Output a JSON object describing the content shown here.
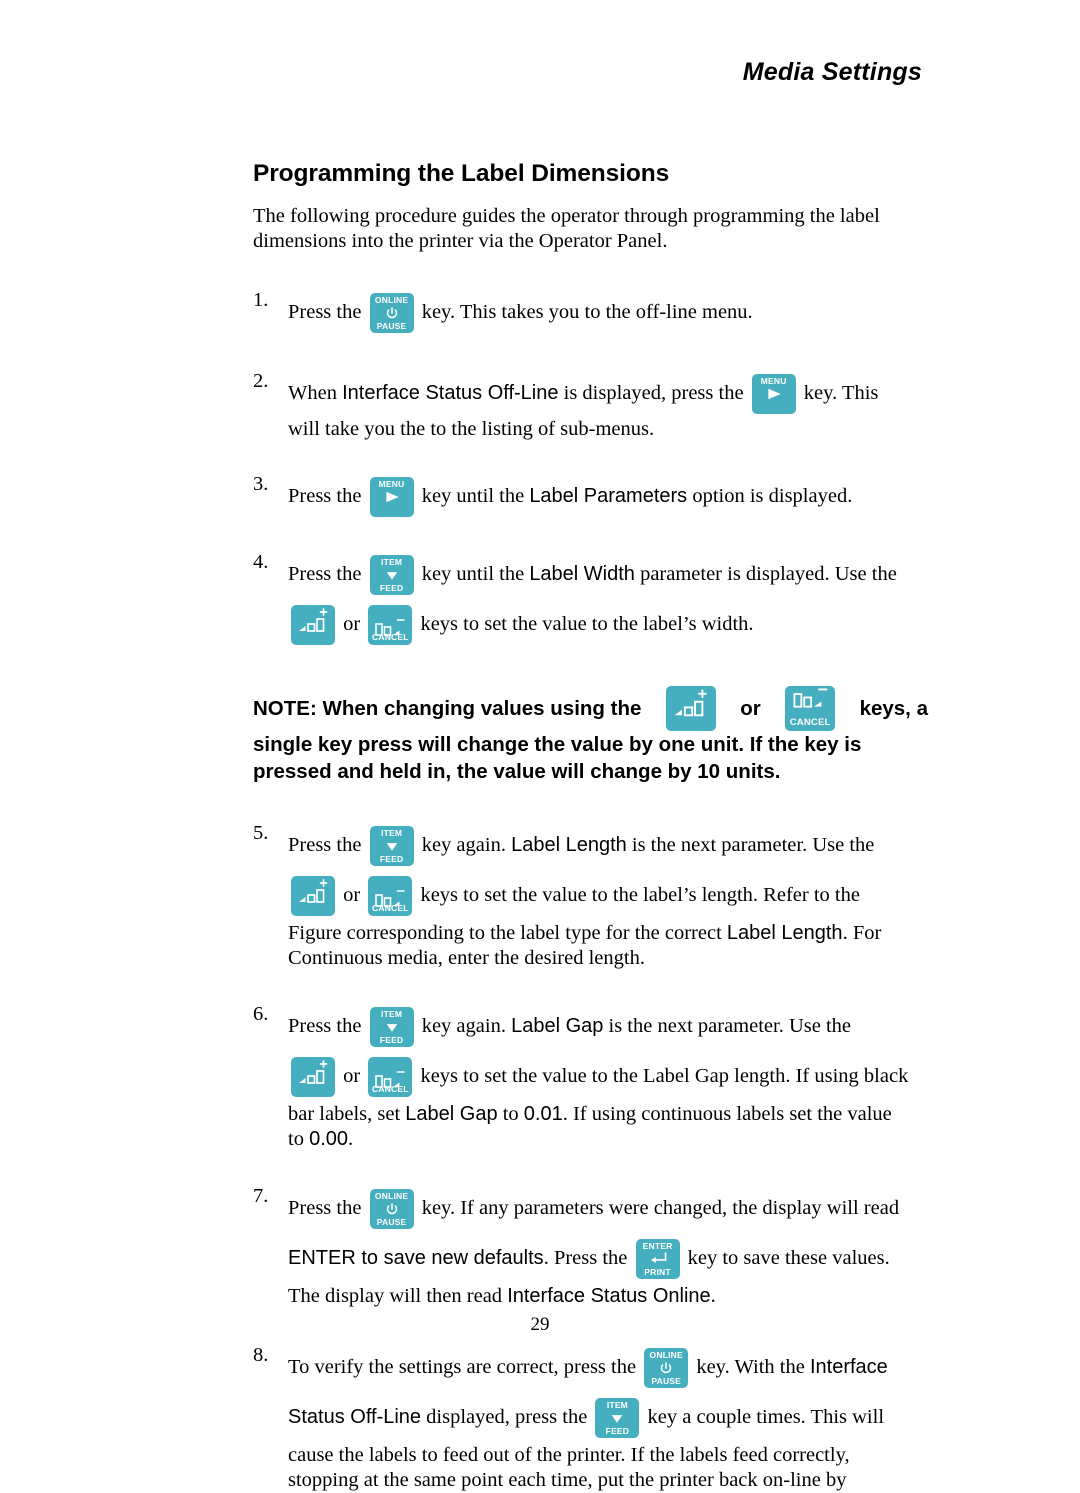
{
  "header": {
    "running_head": "Media Settings"
  },
  "section": {
    "title": "Programming the Label Dimensions",
    "intro": "The following procedure guides the operator through programming the label dimensions into the printer via the Operator Panel."
  },
  "keys": {
    "online_pause": {
      "top": "ONLINE",
      "bottom": "PAUSE",
      "glyph": "power-icon"
    },
    "menu": {
      "top": "MENU",
      "bottom": "",
      "glyph": "triangle-right-icon"
    },
    "item_feed": {
      "top": "ITEM",
      "bottom": "FEED",
      "glyph": "triangle-down-icon"
    },
    "increase": {
      "top": "",
      "bottom": "",
      "glyph": "bars-up-plus-icon"
    },
    "cancel": {
      "top": "",
      "bottom": "CANCEL",
      "glyph": "bars-down-minus-icon"
    },
    "enter_print": {
      "top": "ENTER",
      "bottom": "PRINT",
      "glyph": "return-arrow-icon"
    }
  },
  "steps": [
    {
      "num": "1.",
      "lines": [
        {
          "before": "Press the ",
          "key": "online_pause",
          "after": " key. This takes you to the off-line menu."
        }
      ]
    },
    {
      "num": "2.",
      "line1_a": "When ",
      "line1_term": "Interface Status Off-Line",
      "line1_b": " is displayed, press the ",
      "line1_c": " key. This",
      "line2": "will take you the to the listing of sub-menus."
    },
    {
      "num": "3.",
      "a": "Press the ",
      "b": " key until the ",
      "term": "Label Parameters",
      "c": " option is displayed."
    },
    {
      "num": "4.",
      "a": "Press the ",
      "b": " key until the ",
      "term": "Label Width",
      "c": " parameter is displayed. Use the",
      "d": " or ",
      "e": " keys to set the value to the label’s width."
    },
    {
      "num": "5.",
      "a": "Press the ",
      "b": " key again. ",
      "term1": "Label Length",
      "c": " is the next parameter. Use the",
      "d": " or ",
      "e": " keys to set the value to the label’s length. Refer to the",
      "f": "Figure corresponding to the label type for the correct ",
      "term2": "Label Length",
      "g": ". For",
      "h": "Continuous media, enter the desired length."
    },
    {
      "num": "6.",
      "a": "Press the ",
      "b": " key again. ",
      "term1": "Label Gap",
      "c": " is the next parameter. Use the",
      "d": " or ",
      "e": " keys to set the value to the Label Gap length. If using black",
      "f": "bar labels, set ",
      "term2": "Label Gap",
      "g": " to ",
      "value1": "0.01",
      "h": ". If using continuous labels set the value",
      "i": "to ",
      "value2": "0.00",
      "j": "."
    },
    {
      "num": "7.",
      "a": "Press the ",
      "b": " key. If any parameters were changed, the display will read",
      "term1": "ENTER to save new defaults",
      "c": ". Press the ",
      "d": " key to save these values.",
      "e": "The display will then read ",
      "term2": "Interface Status Online",
      "f": "."
    },
    {
      "num": "8.",
      "a": "To verify the settings are correct, press the ",
      "b": " key. With the ",
      "term1": "Interface",
      "term2": "Status Off-Line",
      "c": " displayed, press the ",
      "d": " key a couple times. This will",
      "e": "cause the labels to feed out of the printer. If the labels feed correctly,",
      "f": "stopping at the same point each time, put the printer back on-line by"
    }
  ],
  "note": {
    "line1_a": "NOTE: When changing values using the ",
    "line1_or": " or ",
    "line1_b": " keys, a",
    "line2": "single key press will change the value by one unit. If the key is",
    "line3": "pressed and held in, the value will change by 10 units."
  },
  "footer": {
    "page_number": "29"
  },
  "colors": {
    "key_face": "#45AFBF",
    "key_text": "#FFFFFF",
    "body_text": "#000000"
  }
}
